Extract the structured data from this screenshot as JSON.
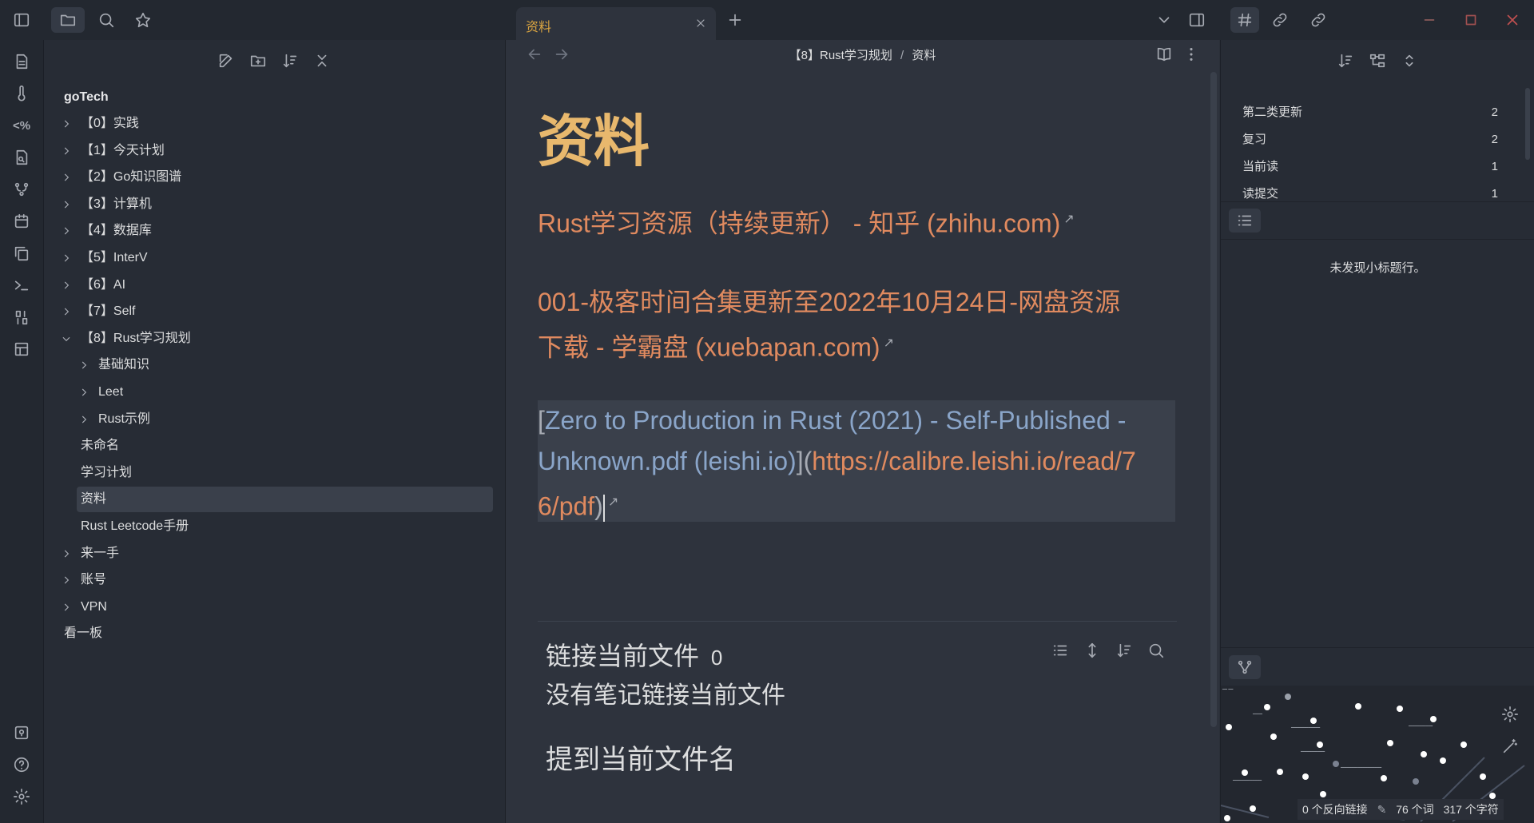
{
  "topbar": {
    "icons": [
      "sidebar-toggle-icon",
      "folder-icon",
      "search-icon",
      "star-icon"
    ],
    "tab_title": "资料",
    "right_icons": [
      "chevron-down-icon",
      "split-view-icon",
      "hash-icon",
      "link-out-icon",
      "link-in-icon"
    ],
    "window_controls": [
      "minimize-icon",
      "maximize-icon",
      "close-icon"
    ]
  },
  "ribbon": {
    "icons": [
      "file-icon",
      "thermometer-icon",
      "percent-code-icon",
      "file-search-icon",
      "branch-icon",
      "calendar-icon",
      "copy-icon",
      "terminal-icon",
      "binary-icon",
      "table-icon"
    ],
    "bottom_icons": [
      "help-doc-icon",
      "help-icon",
      "settings-icon"
    ]
  },
  "left_panel": {
    "toolbar_icons": [
      "new-note-icon",
      "new-folder-icon",
      "sort-icon",
      "collapse-icon"
    ],
    "vault_name": "goTech",
    "tree": [
      {
        "label": "【0】实践",
        "level": 0,
        "folder": true,
        "open": false
      },
      {
        "label": "【1】今天计划",
        "level": 0,
        "folder": true,
        "open": false
      },
      {
        "label": "【2】Go知识图谱",
        "level": 0,
        "folder": true,
        "open": false
      },
      {
        "label": "【3】计算机",
        "level": 0,
        "folder": true,
        "open": false
      },
      {
        "label": "【4】数据库",
        "level": 0,
        "folder": true,
        "open": false
      },
      {
        "label": "【5】InterV",
        "level": 0,
        "folder": true,
        "open": false
      },
      {
        "label": "【6】AI",
        "level": 0,
        "folder": true,
        "open": false
      },
      {
        "label": "【7】Self",
        "level": 0,
        "folder": true,
        "open": false
      },
      {
        "label": "【8】Rust学习规划",
        "level": 0,
        "folder": true,
        "open": true
      },
      {
        "label": "基础知识",
        "level": 1,
        "folder": true,
        "open": false
      },
      {
        "label": "Leet",
        "level": 1,
        "folder": true,
        "open": false
      },
      {
        "label": "Rust示例",
        "level": 1,
        "folder": true,
        "open": false
      },
      {
        "label": "未命名",
        "level": 1,
        "folder": false
      },
      {
        "label": "学习计划",
        "level": 1,
        "folder": false
      },
      {
        "label": "资料",
        "level": 1,
        "folder": false,
        "active": true
      },
      {
        "label": "Rust Leetcode手册",
        "level": 1,
        "folder": false
      },
      {
        "label": "来一手",
        "level": 0,
        "folder": true,
        "open": false
      },
      {
        "label": "账号",
        "level": 0,
        "folder": true,
        "open": false
      },
      {
        "label": "VPN",
        "level": 0,
        "folder": true,
        "open": false
      },
      {
        "label": "看一板",
        "level": 0,
        "folder": false
      }
    ]
  },
  "editor": {
    "breadcrumb_parent": "【8】Rust学习规划",
    "breadcrumb_sep": "/",
    "breadcrumb_current": "资料",
    "title": "资料",
    "link1": "Rust学习资源（持续更新） - 知乎 (zhihu.com)",
    "link2_line1": "001-极客时间合集更新至2022年10月24日-网盘资源",
    "link2_line2": "下载 - 学霸盘 (xuebapan.com)",
    "md_open": "[",
    "md_text_line1": "Zero to Production in Rust (2021) - Self-Published -",
    "md_text_line2": "Unknown.pdf (leishi.io)",
    "md_mid": "](",
    "md_url_line2": "https://calibre.leishi.io/read/7",
    "md_url_line3": "6/pdf",
    "md_close": ")",
    "backlinks_title": "链接当前文件",
    "backlinks_count": "0",
    "backlinks_empty": "没有笔记链接当前文件",
    "mentions_title": "提到当前文件名"
  },
  "right_panel": {
    "toolbar_icons": [
      "sort-icon",
      "tree-icon",
      "expand-icon"
    ],
    "tags": [
      {
        "name": "第二类更新",
        "count": "2"
      },
      {
        "name": "复习",
        "count": "2"
      },
      {
        "name": "当前读",
        "count": "1"
      },
      {
        "name": "读提交",
        "count": "1"
      }
    ],
    "outline_empty": "未发现小标题行。",
    "status": {
      "backlinks": "0 个反向链接",
      "words": "76 个词",
      "chars": "317 个字符"
    }
  },
  "colors": {
    "accent_title": "#e8b86d",
    "link_orange": "#e08a5f",
    "link_blue": "#8aa5c9",
    "active_tab": "#d9a441"
  }
}
